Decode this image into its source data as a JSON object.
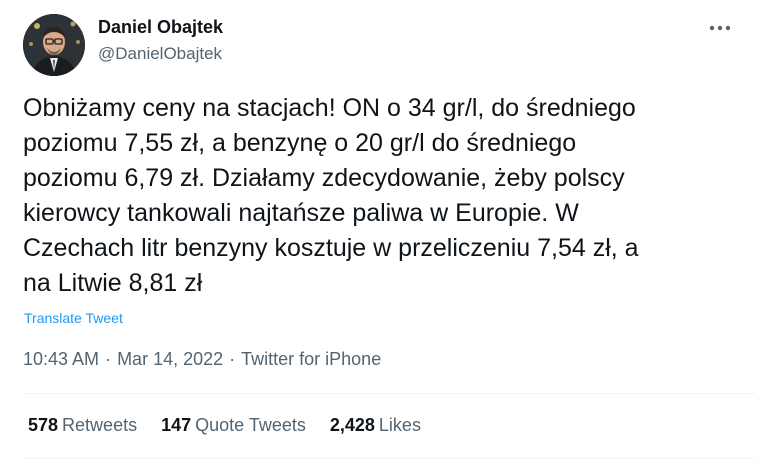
{
  "author": {
    "name": "Daniel Obajtek",
    "handle": "@DanielObajtek"
  },
  "menu": {
    "icon": "more-horizontal-icon"
  },
  "tweet": {
    "text": "Obniżamy ceny na stacjach! ON o 34 gr/l, do średniego\npoziomu 7,55 zł, a benzynę o 20 gr/l do średniego\npoziomu 6,79 zł. Działamy zdecydowanie, żeby polscy\nkierowcy tankowali najtańsze paliwa w Europie. W\nCzechach litr benzyny kosztuje w przeliczeniu 7,54 zł, a\nna Litwie 8,81 zł",
    "translate_label": "Translate Tweet",
    "time": "10:43 AM",
    "date": "Mar 14, 2022",
    "source": "Twitter for iPhone",
    "separator": "·"
  },
  "stats": [
    {
      "count": "578",
      "label": "Retweets"
    },
    {
      "count": "147",
      "label": "Quote Tweets"
    },
    {
      "count": "2,428",
      "label": "Likes"
    }
  ],
  "colors": {
    "text": "#0f1419",
    "secondary": "#536471",
    "link": "#1d9bf0",
    "divider": "#eff3f4"
  }
}
